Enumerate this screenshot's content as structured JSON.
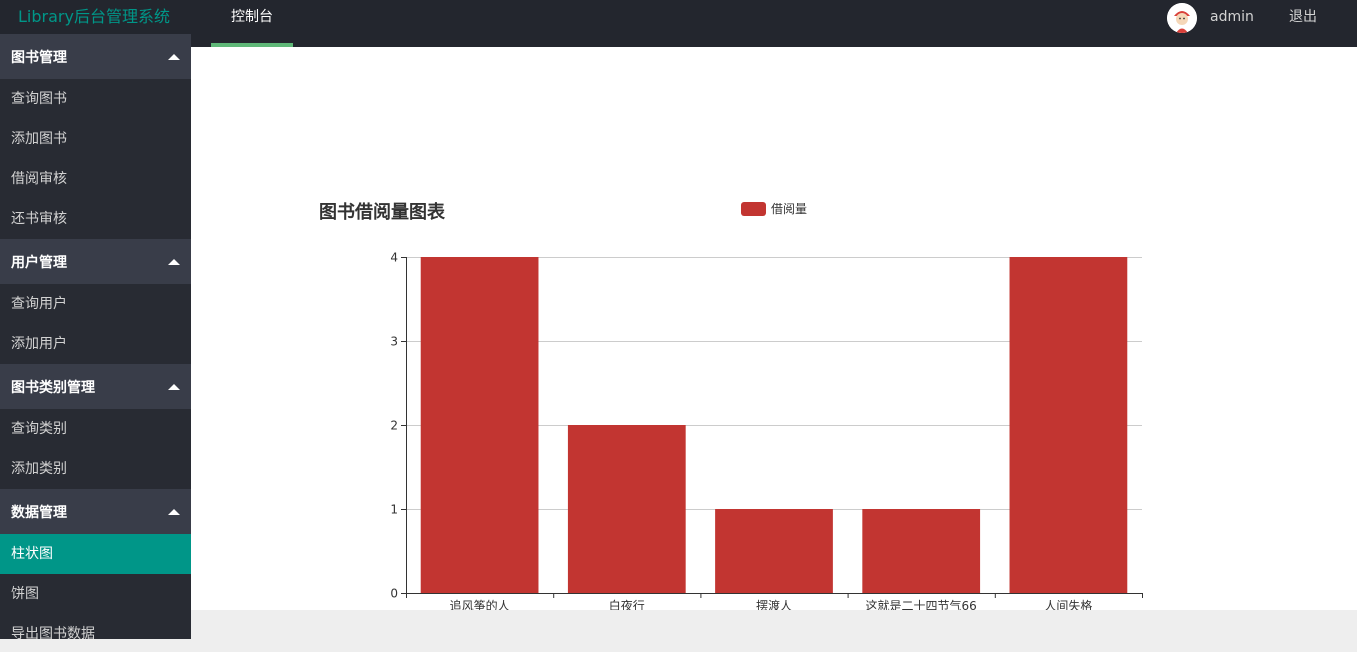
{
  "header": {
    "logo": "Library后台管理系统",
    "tab": "控制台",
    "user": "admin",
    "logout": "退出"
  },
  "sidebar": {
    "groups": [
      {
        "title": "图书管理",
        "items": [
          "查询图书",
          "添加图书",
          "借阅审核",
          "还书审核"
        ]
      },
      {
        "title": "用户管理",
        "items": [
          "查询用户",
          "添加用户"
        ]
      },
      {
        "title": "图书类别管理",
        "items": [
          "查询类别",
          "添加类别"
        ]
      },
      {
        "title": "数据管理",
        "items": [
          "柱状图",
          "饼图",
          "导出图书数据"
        ]
      }
    ],
    "active_item": "柱状图"
  },
  "colors": {
    "accent": "#009688",
    "bar": "#c23531",
    "tab_underline": "#5fb878"
  },
  "chart_data": {
    "type": "bar",
    "title": "图书借阅量图表",
    "categories": [
      "追风筝的人",
      "白夜行",
      "摆渡人",
      "这就是二十四节气66",
      "人间失格"
    ],
    "series": [
      {
        "name": "借阅量",
        "values": [
          4,
          2,
          1,
          1,
          4
        ]
      }
    ],
    "ylim": [
      0,
      4
    ],
    "yticks": [
      0,
      1,
      2,
      3,
      4
    ],
    "grid": true,
    "legend": "top-center"
  }
}
